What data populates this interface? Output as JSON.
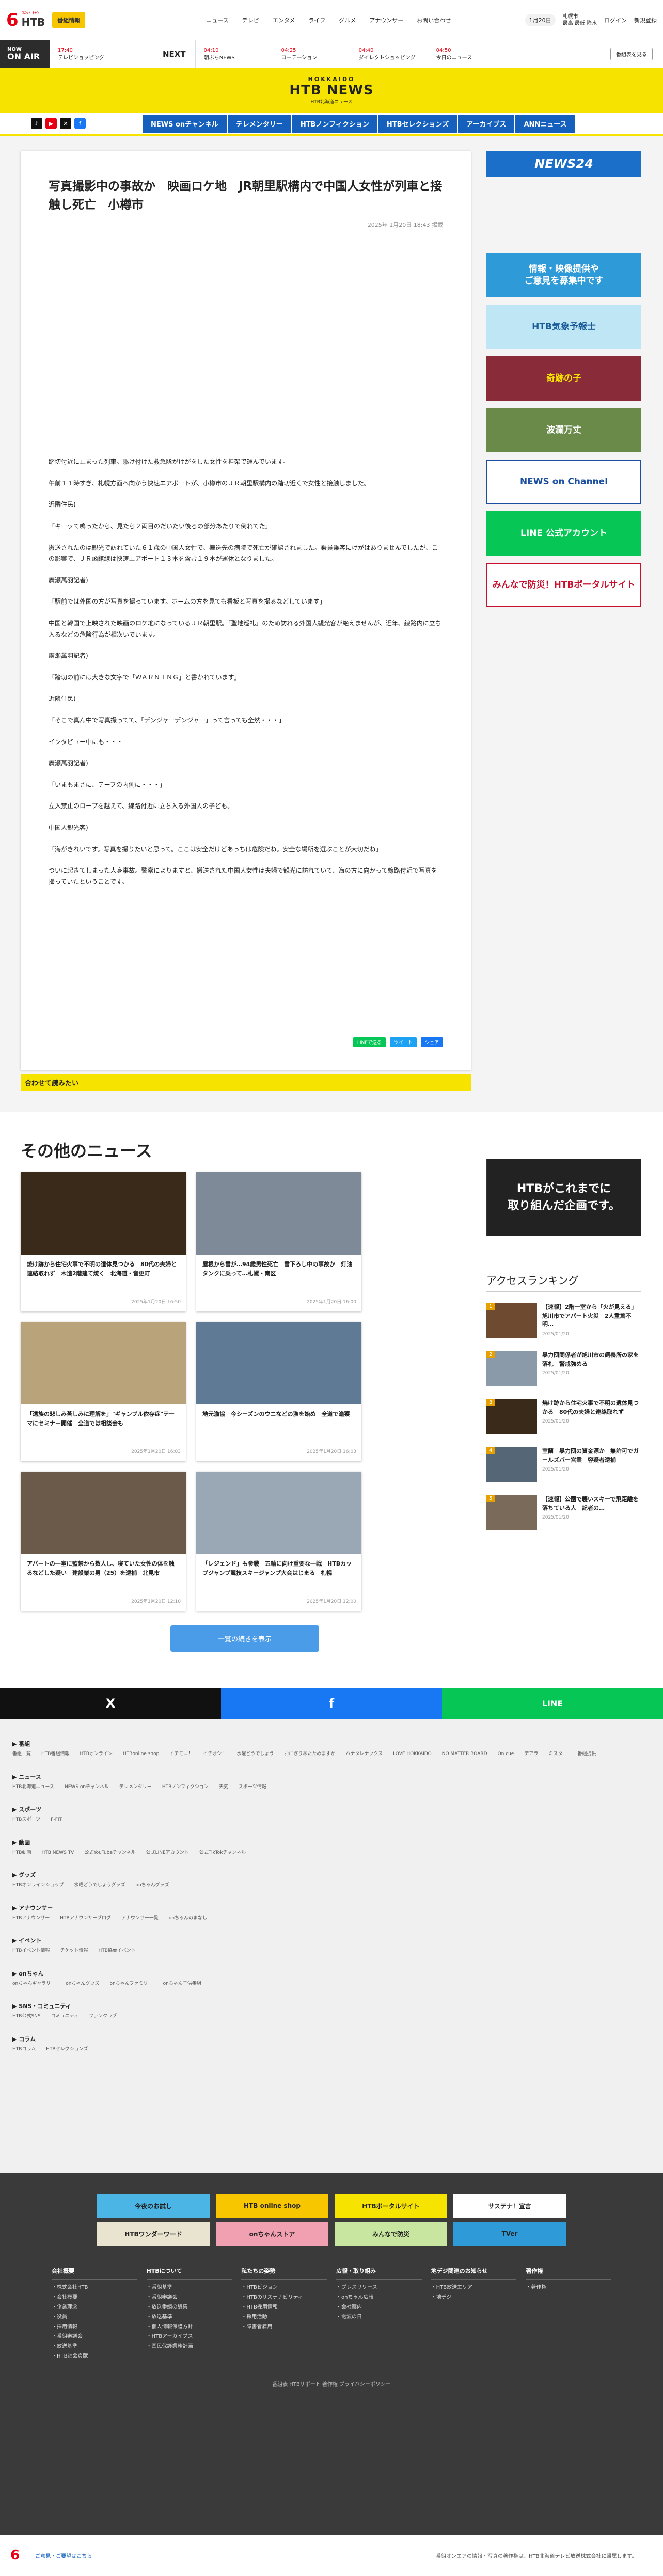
{
  "header": {
    "logo_main": "6",
    "logo_brand": "HTB",
    "logo_sub": "ｺﾒｯﾄ ﾁｬﾝ",
    "program_btn": "番組情報",
    "nav": [
      "ニュース",
      "テレビ",
      "エンタメ",
      "ライフ",
      "グルメ",
      "アナウンサー",
      "お問い合わせ"
    ],
    "date": "1月20日",
    "weather_title": "札幌市",
    "weather_line": "最高 最低 降水",
    "login": "ログイン",
    "register": "新規登録"
  },
  "onair": {
    "now_label": "NOW",
    "on_air": "ON AIR",
    "now_time": "17:40",
    "now_title": "テレビショッピング",
    "next_label": "NEXT",
    "items": [
      {
        "time": "04:10",
        "title": "朝ぶちNEWS"
      },
      {
        "time": "04:25",
        "title": "ローテーション"
      },
      {
        "time": "04:40",
        "title": "ダイレクトショッピング"
      },
      {
        "time": "04:50",
        "title": "今日のニュース"
      }
    ],
    "search_label": "番組表を見る"
  },
  "brand": {
    "hokkaido": "HOKKAIDO",
    "news": "HTB NEWS",
    "sub": "HTB北海道ニュース"
  },
  "subnav": [
    "NEWS onチャンネル",
    "テレメンタリー",
    "HTBノンフィクション",
    "HTBセレクションズ",
    "アーカイブス",
    "ANNニュース"
  ],
  "article": {
    "title": "写真撮影中の事故か　映画ロケ地　JR朝里駅構内で中国人女性が列車と接触し死亡　小樽市",
    "date": "2025年 1月20日 18:43 掲載",
    "paragraphs": [
      "踏切付近に止まった列車。駆け付けた救急隊がけがをした女性を担架で運んでいます。",
      "午前１１時すぎ、札幌方面へ向かう快速エアポートが、小樽市のＪＲ朝里駅構内の踏切近くで女性と接触しました。",
      "近隣住民)",
      "「キーッて鳴ったから、見たら２両目のだいたい後ろの部分あたりで倒れてた」",
      "搬送されたのは観光で訪れていた６１歳の中国人女性で、搬送先の病院で死亡が確認されました。乗員乗客にけがはありませんでしたが、この影響で、ＪＲ函館線は快速エアポート１３本を含む１９本が運休となりました。",
      "廣瀬萬羽記者)",
      "「駅前では外国の方が写真を撮っています。ホームの方を見ても看板と写真を撮るなどしています」",
      "中国と韓国で上映された映画のロケ地になっているＪＲ朝里駅。「聖地巡礼」のため訪れる外国人観光客が絶えませんが、近年、線路内に立ち入るなどの危険行為が相次いでいます。",
      "廣瀬萬羽記者)",
      "「踏切の前には大きな文字で「ＷＡＲＮＩＮＧ」と書かれています」",
      "近隣住民)",
      "「そこで真ん中で写真撮ってて、「デンジャーデンジャー」って言っても全然・・・」",
      "インタビュー中にも・・・",
      "廣瀬萬羽記者)",
      "「いまもまさに、テープの内側に・・・」",
      "立入禁止のロープを越えて、線路付近に立ち入る外国人の子ども。",
      "中国人観光客)",
      "「海がきれいです。写真を撮りたいと思って。ここは安全だけどあっちは危険だね。安全な場所を選ぶことが大切だね」",
      "ついに起きてしまった人身事故。警察によりますと、搬送された中国人女性は夫婦で観光に訪れていて、海の方に向かって線路付近で写真を撮っていたということです。"
    ],
    "share": [
      "LINEで送る",
      "ツイート",
      "シェア"
    ],
    "related_label": "合わせて読みたい"
  },
  "sidebar": {
    "news24": "NEWS24",
    "banners": [
      "情報・映像提供や\nご意見を募集中です",
      "HTB気象予報士",
      "奇跡の子",
      "波瀾万丈",
      "NEWS on Channel",
      "LINE 公式アカウント",
      "みんなで防災！HTBポータルサイト"
    ]
  },
  "other_news": {
    "heading": "その他のニュース",
    "cards": [
      {
        "title": "焼け跡から住宅火事で不明の遺体見つかる　80代の夫婦と連絡取れず　木造2階建て焼く　北海道・音更町",
        "date": "2025年1月20日 16:50"
      },
      {
        "title": "屋根から雪が…94歳男性死亡　雪下ろし中の事故か　灯油タンクに乗って…札幌・南区",
        "date": "2025年1月20日 16:00"
      },
      {
        "title": "「遺族の悲しみ苦しみに理解を」\"ギャンブル依存症\"テーマにセミナー開催　全道では相談会も",
        "date": "2025年1月20日 16:03"
      },
      {
        "title": "地元漁協　今シーズンのウニなどの漁を始め　全道で漁獲",
        "date": "2025年1月20日 16:03"
      },
      {
        "title": "アパートの一室に監禁から数人し、寝ていた女性の体を触るなどした疑い　建設業の男（25）を逮捕　北見市",
        "date": "2025年1月20日 12:10"
      },
      {
        "title": "「レジェンド」も参戦　五輪に向け重要な一戦　HTBカップジャンプ競技スキージャンプ大会はじまる　札幌",
        "date": "2025年1月20日 12:00"
      }
    ],
    "more_btn": "一覧の続きを表示"
  },
  "other_side": {
    "ad_text": "HTBがこれまでに\n取り組んだ企画です。",
    "ranking_heading": "アクセスランキング",
    "ranking": [
      {
        "rank": "1",
        "title": "【速報】2階一室から「火が見える」旭川市でアパート火災　2人重篤不明…",
        "date": "2025/01/20"
      },
      {
        "rank": "2",
        "title": "暴力団関係者が旭川市の飼養所の家を落札　警戒強める",
        "date": "2025/01/20"
      },
      {
        "rank": "3",
        "title": "焼け跡から住宅火事で不明の遺体見つかる　80代の夫婦と連絡取れず",
        "date": "2025/01/20"
      },
      {
        "rank": "4",
        "title": "室蘭　暴力団の資金源か　無許可でガールズバー営業　容疑者逮捕",
        "date": "2025/01/20"
      },
      {
        "rank": "5",
        "title": "【速報】公園で襲いスキーで飛距離を落ちている人　記者の…",
        "date": "2025/01/20"
      }
    ]
  },
  "sharebar": [
    "X",
    "f",
    "LINE"
  ],
  "footer": {
    "sections": [
      {
        "title": "番組",
        "items": [
          "番組一覧",
          "HTB番組情報",
          "HTBオンライン",
          "HTBonline shop",
          "イチモニ！",
          "イチオシ！",
          "水曜どうでしょう",
          "おにぎりあたためますか",
          "ハナタレナックス",
          "LOVE HOKKAIDO",
          "NO MATTER BOARD",
          "On cue",
          "デアラ",
          "ミスター",
          "番組提供"
        ]
      },
      {
        "title": "ニュース",
        "items": [
          "HTB北海道ニュース",
          "NEWS onチャンネル",
          "テレメンタリー",
          "HTBノンフィクション",
          "天気",
          "スポーツ情報"
        ]
      },
      {
        "title": "スポーツ",
        "items": [
          "HTBスポーツ",
          "F-FIT"
        ]
      },
      {
        "title": "動画",
        "items": [
          "HTB動画",
          "HTB NEWS TV",
          "公式YouTubeチャンネル",
          "公式LINEアカウント",
          "公式TikTokチャンネル"
        ]
      },
      {
        "title": "グッズ",
        "items": [
          "HTBオンラインショップ",
          "水曜どうでしょうグッズ",
          "onちゃんグッズ"
        ]
      },
      {
        "title": "アナウンサー",
        "items": [
          "HTBアナウンサー",
          "HTBアナウンサーブログ",
          "アナウンサー一覧",
          "onちゃんのまなし"
        ]
      },
      {
        "title": "イベント",
        "items": [
          "HTBイベント情報",
          "チケット情報",
          "HTB協賛イベント"
        ]
      },
      {
        "title": "onちゃん",
        "items": [
          "onちゃんギャラリー",
          "onちゃんグッズ",
          "onちゃんファミリー",
          "onちゃん子供番組"
        ]
      },
      {
        "title": "SNS・コミュニティ",
        "items": [
          "HTB公式SNS",
          "コミュニティ",
          "ファンクラブ"
        ]
      },
      {
        "title": "コラム",
        "items": [
          "HTBコラム",
          "HTBセレクションズ"
        ]
      }
    ],
    "banners": [
      "今夜のお試し",
      "HTB online shop",
      "HTBポータルサイト",
      "サステナ！宣言",
      "HTBワンダーワード",
      "onちゃんストア",
      "みんなで防災",
      "TVer"
    ],
    "cols": [
      {
        "h": "会社概要",
        "items": [
          "株式会社HTB",
          "会社概要",
          "企業理念",
          "役員",
          "採用情報",
          "番組審議会",
          "放送基準",
          "HTB社会貢献"
        ]
      },
      {
        "h": "HTBについて",
        "items": [
          "番組基準",
          "番組審議会",
          "放送番組の編集",
          "放送基準",
          "個人情報保護方針",
          "HTBアーカイブス",
          "国民保護業務計画"
        ]
      },
      {
        "h": "私たちの姿勢",
        "items": [
          "HTBビジョン",
          "HTBのサステナビリティ",
          "HTB採用情報",
          "採用活動",
          "障害者雇用"
        ]
      },
      {
        "h": "広報・取り組み",
        "items": [
          "プレスリリース",
          "onちゃん広報",
          "会社案内",
          "電波の日"
        ]
      },
      {
        "h": "地デジ関連のお知らせ",
        "items": [
          "HTB放送エリア",
          "地デジ"
        ]
      },
      {
        "h": "著作権",
        "items": [
          "著作権"
        ]
      }
    ],
    "bottom_links": "番組表 HTBサポート 著作権 プライバシーポリシー",
    "copyright_note": "番組オンエアの情報・写真の著作権は、HTB北海道テレビ放送株式会社に帰属します。",
    "end_link": "ご意見・ご要望はこちら"
  }
}
